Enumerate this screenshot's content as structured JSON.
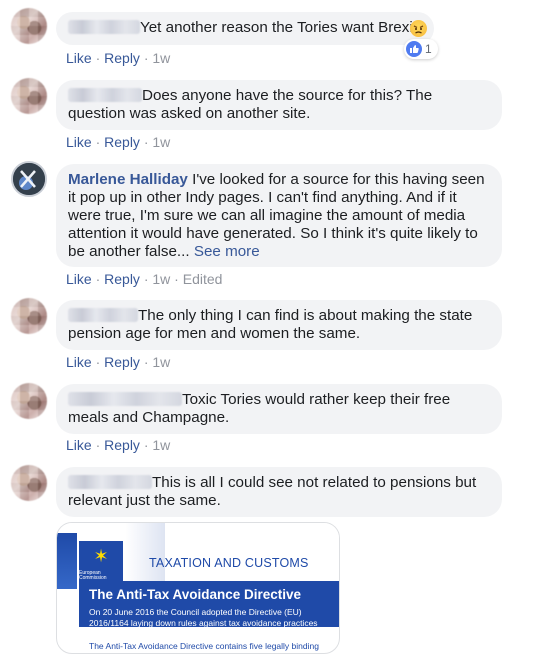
{
  "actions": {
    "like": "Like",
    "reply": "Reply",
    "sep": " · "
  },
  "comments": [
    {
      "text": "Yet another reason the Tories want Brexit",
      "time": "1w",
      "reaction_count": "1"
    },
    {
      "text": "Does anyone have the source for this? The question was asked on another site.",
      "time": "1w"
    },
    {
      "author": "Marlene Halliday",
      "text": " I've looked for a source for this having seen it pop up in other Indy pages. I can't find anything. And if it were true, I'm sure we can all imagine the amount of media attention it would have generated. So I think it's quite likely to be another false...",
      "see_more": "See more",
      "time": "1w",
      "edited": "Edited"
    },
    {
      "text": "The only thing I can find is about making the state pension age for men and women the same.",
      "time": "1w"
    },
    {
      "text": "Toxic Tories would rather keep their free meals and Champagne.",
      "time": "1w"
    },
    {
      "text": "This is all I could see not related to pensions but relevant just the same.",
      "time": "1w"
    }
  ],
  "card": {
    "headline": "TAXATION AND CUSTOMS",
    "title": "The Anti-Tax Avoidance Directive",
    "body": "On 20 June 2016 the Council adopted the Directive (EU) 2016/1164 laying down rules against tax avoidance practices",
    "body2": "The Anti-Tax Avoidance Directive contains five legally binding",
    "logo_text": "European Commission"
  },
  "colors": {
    "link": "#385898",
    "bubble": "#f2f3f5",
    "meta": "#90949c",
    "eu_blue": "#1f4aa8"
  }
}
